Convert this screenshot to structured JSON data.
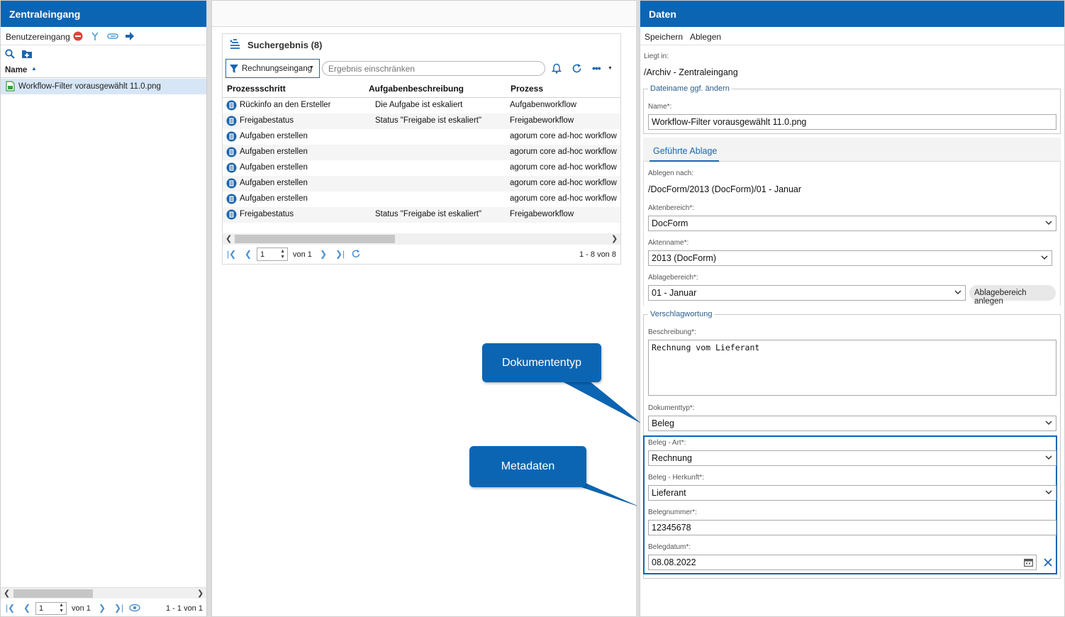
{
  "left": {
    "title": "Zentraleingang",
    "toolbar_label": "Benutzereingang",
    "column_header": "Name",
    "items": [
      {
        "name": "Workflow-Filter vorausgewählt 11.0.png"
      }
    ],
    "pager": {
      "page": "1",
      "of": "von 1",
      "range": "1 - 1 von 1"
    }
  },
  "center": {
    "result_title": "Suchergebnis (8)",
    "filter_button": "Rechnungseingang",
    "search_placeholder": "Ergebnis einschränken",
    "columns": [
      "Prozessschritt",
      "Aufgabenbeschreibung",
      "Prozess"
    ],
    "rows": [
      {
        "step": "Rückinfo an den Ersteller",
        "desc": "Die Aufgabe ist eskaliert",
        "process": "Aufgabenworkflow"
      },
      {
        "step": "Freigabestatus",
        "desc": "Status \"Freigabe ist eskaliert\"",
        "process": "Freigabeworkflow"
      },
      {
        "step": "Aufgaben erstellen",
        "desc": "",
        "process": "agorum core ad-hoc workflow"
      },
      {
        "step": "Aufgaben erstellen",
        "desc": "",
        "process": "agorum core ad-hoc workflow"
      },
      {
        "step": "Aufgaben erstellen",
        "desc": "",
        "process": "agorum core ad-hoc workflow"
      },
      {
        "step": "Aufgaben erstellen",
        "desc": "",
        "process": "agorum core ad-hoc workflow"
      },
      {
        "step": "Aufgaben erstellen",
        "desc": "",
        "process": "agorum core ad-hoc workflow"
      },
      {
        "step": "Freigabestatus",
        "desc": "Status \"Freigabe ist eskaliert\"",
        "process": "Freigabeworkflow"
      }
    ],
    "pager": {
      "page": "1",
      "of": "von 1",
      "range": "1 - 8 von 8"
    }
  },
  "right": {
    "title": "Daten",
    "menu": [
      "Speichern",
      "Ablegen"
    ],
    "location_label": "Liegt in:",
    "location_value": "/Archiv - Zentraleingang",
    "filename_legend": "Dateiname ggf. ändern",
    "name_label": "Name*:",
    "name_value": "Workflow-Filter vorausgewählt 11.0.png",
    "tab": "Geführte Ablage",
    "ablegen_nach_label": "Ablegen nach:",
    "ablegen_nach_value": "/DocForm/2013 (DocForm)/01 - Januar",
    "aktenbereich_label": "Aktenbereich*:",
    "aktenbereich_value": "DocForm",
    "aktenname_label": "Aktenname*:",
    "aktenname_value": "2013 (DocForm)",
    "ablagebereich_label": "Ablagebereich*:",
    "ablagebereich_value": "01 - Januar",
    "ablagebereich_button": "Ablagebereich anlegen",
    "verschlagwortung_legend": "Verschlagwortung",
    "beschreibung_label": "Beschreibung*:",
    "beschreibung_value": "Rechnung vom Lieferant",
    "dokumenttyp_label": "Dokumenttyp*:",
    "dokumenttyp_value": "Beleg",
    "beleg_art_label": "Beleg - Art*:",
    "beleg_art_value": "Rechnung",
    "beleg_herkunft_label": "Beleg - Herkunft*:",
    "beleg_herkunft_value": "Lieferant",
    "belegnummer_label": "Belegnummer*:",
    "belegnummer_value": "12345678",
    "belegdatum_label": "Belegdatum*:",
    "belegdatum_value": "08.08.2022"
  },
  "callouts": {
    "dokumententyp": "Dokumententyp",
    "metadaten": "Metadaten"
  },
  "colors": {
    "accent": "#0c65b3",
    "callout": "#0c65b3"
  }
}
